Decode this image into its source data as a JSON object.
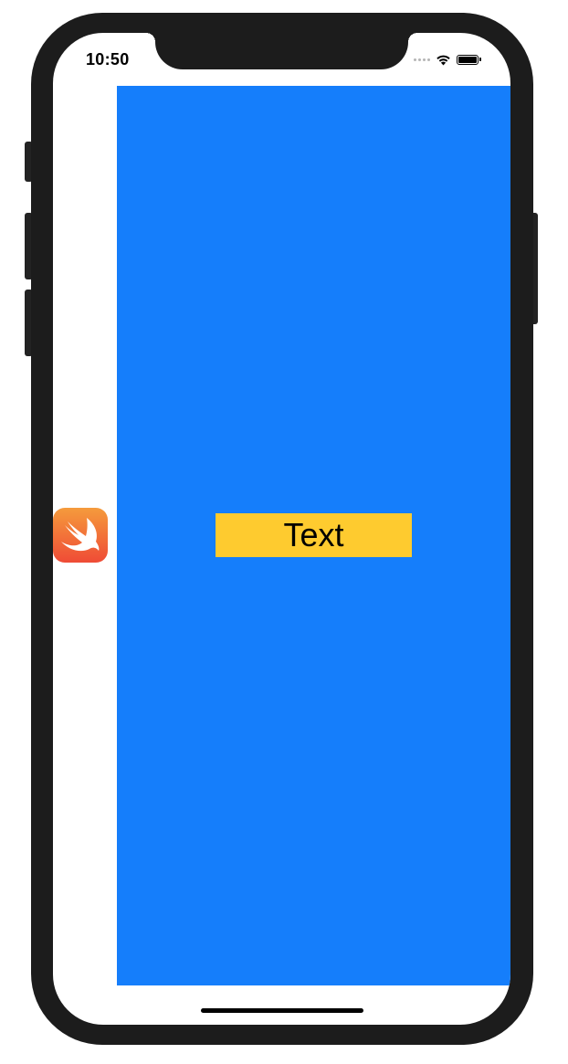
{
  "status_bar": {
    "time": "10:50",
    "wifi_icon": "wifi-icon",
    "battery_icon": "battery-icon",
    "signal_icon": "signal-dots-icon"
  },
  "content_view": {
    "background_color": "#157efb"
  },
  "label": {
    "text": "Text",
    "background_color": "#fecb2f",
    "text_color": "#000000"
  },
  "app_icon": {
    "name": "swift-logo-icon",
    "gradient_top": "#f59b3c",
    "gradient_bottom": "#ef4b36"
  },
  "home_indicator": {
    "color": "#000000"
  }
}
